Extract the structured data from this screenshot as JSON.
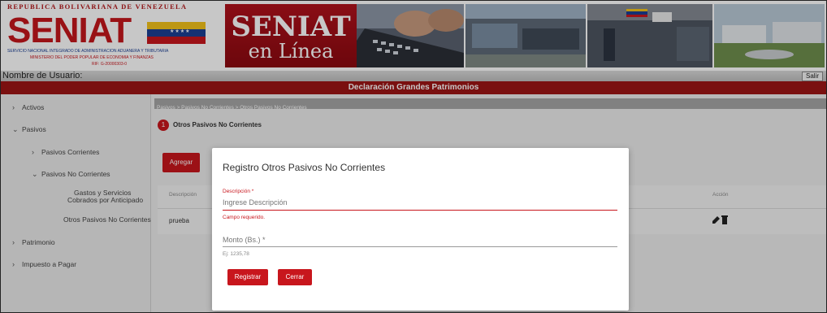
{
  "header": {
    "republica": "REPUBLICA BOLIVARIANA DE VENEZUELA",
    "logo_text": "SENIAT",
    "logo_sub1": "SERVICIO NACIONAL INTEGRADO DE ADMINISTRACION ADUANERA Y TRIBUTARIA",
    "logo_sub2": "MINISTERIO DEL PODER POPULAR DE ECONOMIA Y FINANZAS",
    "logo_sub3": "RIF: G-20000303-0",
    "seniat": "SENIAT",
    "en_linea": "en Línea"
  },
  "userbar": {
    "label": "Nombre de Usuario:",
    "salir": "Salir"
  },
  "title": "Declaración Grandes Patrimonios",
  "sidebar": {
    "activos": "Activos",
    "pasivos": "Pasivos",
    "pasivos_corrientes": "Pasivos Corrientes",
    "pasivos_no_corrientes": "Pasivos No Corrientes",
    "gastos_1": "Gastos y Servicios",
    "gastos_2": "Cobrados por Anticipado",
    "otros": "Otros Pasivos No Corrientes",
    "patrimonio": "Patrimonio",
    "impuesto": "Impuesto a Pagar"
  },
  "breadcrumb": "Pasivos > Pasivos No Corrientes > Otros Pasivos No Corrientes",
  "step": {
    "number": "1",
    "label": "Otros Pasivos No Corrientes"
  },
  "agregar": "Agregar",
  "table": {
    "col_descripcion": "Descripción",
    "col_accion": "Acción",
    "row1_descripcion": "prueba"
  },
  "modal": {
    "title": "Registro Otros Pasivos No Corrientes",
    "descripcion_label": "Descripción *",
    "descripcion_placeholder": "Ingrese Descripción",
    "descripcion_error": "Campo requerido.",
    "monto_label": "Monto (Bs.) *",
    "monto_hint": "Ej: 1235,78",
    "registrar": "Registrar",
    "cerrar": "Cerrar"
  },
  "colors": {
    "accent": "#c8161d",
    "titlebar": "#9d1515"
  }
}
